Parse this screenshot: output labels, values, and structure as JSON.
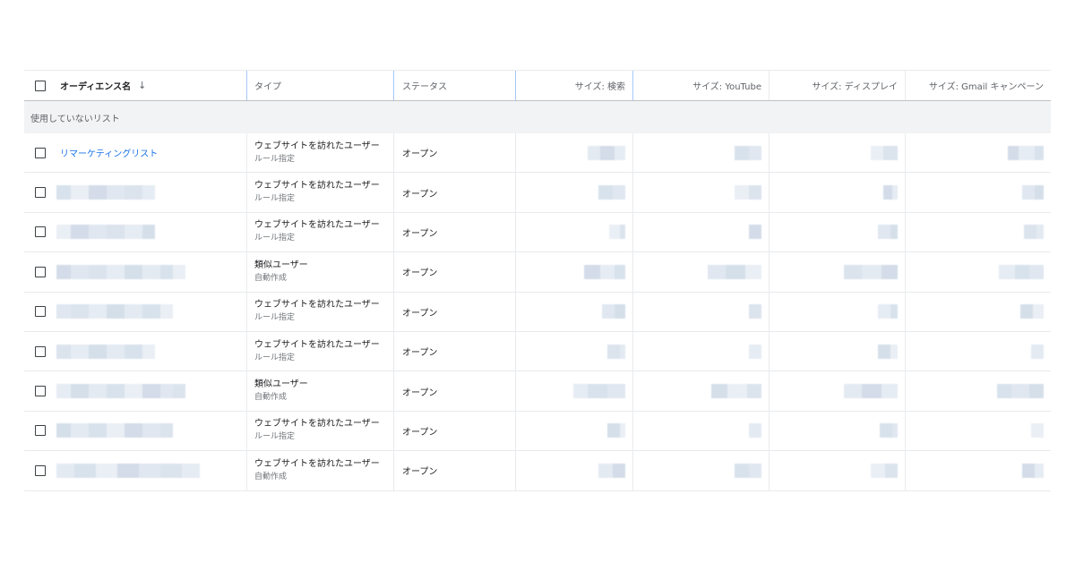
{
  "table": {
    "headers": {
      "name": "オーディエンス名",
      "type": "タイプ",
      "status": "ステータス",
      "size_search": "サイズ: 検索",
      "size_youtube": "サイズ: YouTube",
      "size_display": "サイズ: ディスプレイ",
      "size_gmail": "サイズ: Gmail キャンペーン"
    },
    "group_label": "使用していないリスト",
    "rows": [
      {
        "name": "リマーケティングリスト",
        "type": "ウェブサイトを訪れたユーザー",
        "subtype": "ルール指定",
        "status": "オープン"
      },
      {
        "name": "",
        "type": "ウェブサイトを訪れたユーザー",
        "subtype": "ルール指定",
        "status": "オープン"
      },
      {
        "name": "",
        "type": "ウェブサイトを訪れたユーザー",
        "subtype": "ルール指定",
        "status": "オープン"
      },
      {
        "name": "",
        "type": "類似ユーザー",
        "subtype": "自動作成",
        "status": "オープン"
      },
      {
        "name": "",
        "type": "ウェブサイトを訪れたユーザー",
        "subtype": "ルール指定",
        "status": "オープン"
      },
      {
        "name": "",
        "type": "ウェブサイトを訪れたユーザー",
        "subtype": "ルール指定",
        "status": "オープン"
      },
      {
        "name": "",
        "type": "類似ユーザー",
        "subtype": "自動作成",
        "status": "オープン"
      },
      {
        "name": "",
        "type": "ウェブサイトを訪れたユーザー",
        "subtype": "ルール指定",
        "status": "オープン"
      },
      {
        "name": "",
        "type": "ウェブサイトを訪れたユーザー",
        "subtype": "自動作成",
        "status": "オープン"
      }
    ]
  },
  "icons": {
    "sort": "arrow-down-icon",
    "checkbox": "checkbox-icon"
  },
  "colors": {
    "link": "#1a73e8",
    "group_bg": "#f1f3f4",
    "redacted": "#d6dfea"
  }
}
